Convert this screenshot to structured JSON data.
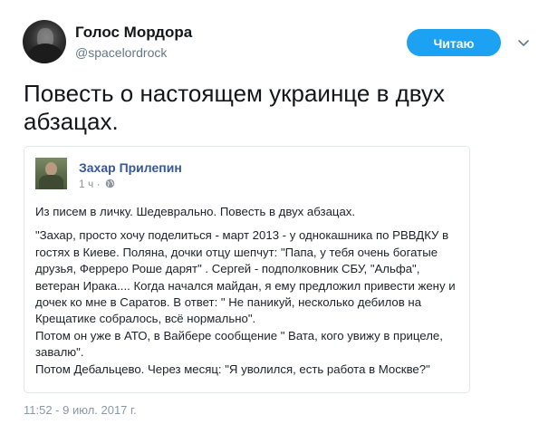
{
  "author": {
    "name": "Голос Мордора",
    "handle": "@spacelordrock"
  },
  "follow_button": {
    "label": "Читаю",
    "color": "#1da1f2"
  },
  "menu": {
    "icon": "chevron-down-icon"
  },
  "tweet": {
    "text": "Повесть о настоящем украинце в двух абзацах.",
    "timestamp": "11:52 - 9 июл. 2017 г."
  },
  "quoted_post": {
    "author": "Захар Прилепин",
    "time": "1 ч",
    "privacy_icon": "globe-icon",
    "lines": [
      "Из писем в личку. Шедеврально. Повесть в двух абзацах.",
      "\"Захар, просто хочу поделиться - март 2013 - у однокашника по РВВДКУ в гостях в Киеве. Поляна, дочки отцу шепчут: \"Папа, у тебя очень богатые друзья, Ферреро Роше дарят\" . Сергей - подполковник СБУ, \"Альфа\", ветеран Ирака.... Когда начался майдан, я ему предложил привести жену и дочек ко мне в Саратов. В ответ: \" Не паникуй, несколько дебилов на Крещатике собралось, всё нормально\".",
      "Потом он уже в АТО, в Вайбере сообщение \" Вата, кого увижу в прицеле, завалю\".",
      "Потом Дебальцево. Через месяц: \"Я уволился, есть работа в Москве?\""
    ]
  }
}
